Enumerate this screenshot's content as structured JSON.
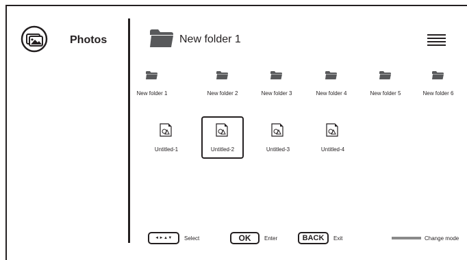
{
  "sidebar": {
    "app_title": "Photos",
    "app_icon": "photo-gallery-icon"
  },
  "header": {
    "breadcrumb": "New folder 1",
    "folder_icon": "folder-icon",
    "menu_icon": "hamburger-menu-icon"
  },
  "grid": {
    "folders": [
      {
        "label": "New folder 1",
        "icon": "folder-icon"
      },
      {
        "label": "New folder 2",
        "icon": "folder-icon"
      },
      {
        "label": "New folder 3",
        "icon": "folder-icon"
      },
      {
        "label": "New folder 4",
        "icon": "folder-icon"
      },
      {
        "label": "New folder 5",
        "icon": "folder-icon"
      },
      {
        "label": "New folder 6",
        "icon": "folder-icon"
      }
    ],
    "files": [
      {
        "label": "Untitled-1",
        "icon": "image-file-icon",
        "selected": false
      },
      {
        "label": "Untitled-2",
        "icon": "image-file-icon",
        "selected": true
      },
      {
        "label": "Untitled-3",
        "icon": "image-file-icon",
        "selected": false
      },
      {
        "label": "Untitled-4",
        "icon": "image-file-icon",
        "selected": false
      }
    ]
  },
  "footer": {
    "select": {
      "key": "◄►▲▼",
      "label": "Select"
    },
    "enter": {
      "key": "OK",
      "label": "Enter"
    },
    "exit": {
      "key": "BACK",
      "label": "Exit"
    },
    "mode": {
      "label": "Change mode",
      "color": "#8a8a8a"
    }
  },
  "colors": {
    "foreground": "#231f20",
    "background": "#ffffff",
    "folder": "#58595b"
  }
}
